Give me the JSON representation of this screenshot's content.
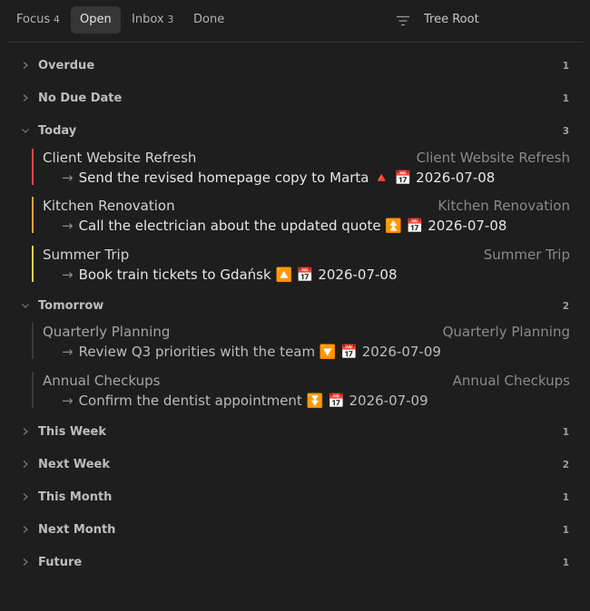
{
  "tabs": [
    {
      "label": "Focus",
      "count": "4",
      "active": false
    },
    {
      "label": "Open",
      "count": "",
      "active": true
    },
    {
      "label": "Inbox",
      "count": "3",
      "active": false
    },
    {
      "label": "Done",
      "count": "",
      "active": false
    }
  ],
  "header": {
    "filter_icon": "filter-icon",
    "tree_root_label": "Tree Root"
  },
  "groups": {
    "overdue": {
      "title": "Overdue",
      "count": "1",
      "expanded": false
    },
    "no_due_date": {
      "title": "No Due Date",
      "count": "1",
      "expanded": false
    },
    "today": {
      "title": "Today",
      "count": "3",
      "expanded": true,
      "projects": [
        {
          "name": "Client Website Refresh",
          "name_right": "Client Website Refresh",
          "bar_color": "#e0474c",
          "arrow": "→",
          "task": "Send the revised homepage copy to Marta 🔺 📅 2026-07-08"
        },
        {
          "name": "Kitchen Renovation",
          "name_right": "Kitchen Renovation",
          "bar_color": "#e8a33a",
          "arrow": "→",
          "task": "Call the electrician about the updated quote ⏫ 📅 2026-07-08"
        },
        {
          "name": "Summer Trip",
          "name_right": "Summer Trip",
          "bar_color": "#e5d44a",
          "arrow": "→",
          "task": "Book train tickets to Gdańsk 🔼 📅 2026-07-08"
        }
      ]
    },
    "tomorrow": {
      "title": "Tomorrow",
      "count": "2",
      "expanded": true,
      "projects": [
        {
          "name": "Quarterly Planning",
          "name_right": "Quarterly Planning",
          "bar_color": "#3a3a3a",
          "arrow": "→",
          "task": "Review Q3 priorities with the team 🔽 📅 2026-07-09"
        },
        {
          "name": "Annual Checkups",
          "name_right": "Annual Checkups",
          "bar_color": "#3a3a3a",
          "arrow": "→",
          "task": "Confirm the dentist appointment ⏬ 📅 2026-07-09"
        }
      ]
    },
    "this_week": {
      "title": "This Week",
      "count": "1",
      "expanded": false
    },
    "next_week": {
      "title": "Next Week",
      "count": "2",
      "expanded": false
    },
    "this_month": {
      "title": "This Month",
      "count": "1",
      "expanded": false
    },
    "next_month": {
      "title": "Next Month",
      "count": "1",
      "expanded": false
    },
    "future": {
      "title": "Future",
      "count": "1",
      "expanded": false
    }
  },
  "colors": {
    "background": "#1e1e1e",
    "active_tab": "#363636"
  }
}
